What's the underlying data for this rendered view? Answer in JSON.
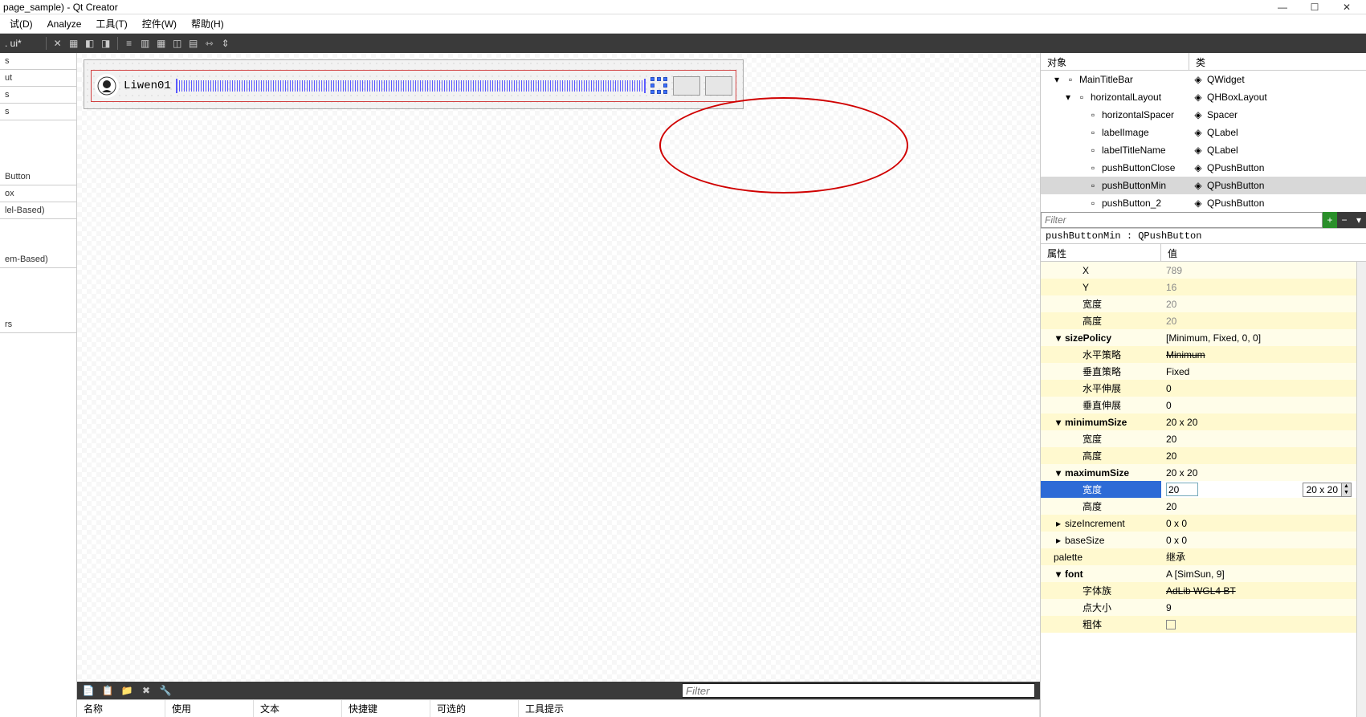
{
  "window": {
    "title": "page_sample) - Qt Creator"
  },
  "menus": [
    "试(D)",
    "Analyze",
    "工具(T)",
    "控件(W)",
    "帮助(H)"
  ],
  "tab_label": ". ui*",
  "canvas": {
    "label_text": "Liwen01"
  },
  "widgetbox": [
    "s",
    "ut",
    "s",
    "s",
    "Button",
    "ox",
    "lel-Based)",
    "em-Based)",
    "rs"
  ],
  "filter_placeholder": "Filter",
  "action_cols": [
    "名称",
    "使用",
    "文本",
    "快捷键",
    "可选的",
    "工具提示"
  ],
  "objtree": {
    "headers": [
      "对象",
      "类"
    ],
    "rows": [
      {
        "indent": 1,
        "chev": "down",
        "name": "MainTitleBar",
        "cls": "QWidget",
        "icon1": "form-icon",
        "icon2": "widget-icon"
      },
      {
        "indent": 2,
        "chev": "down",
        "name": "horizontalLayout",
        "cls": "QHBoxLayout",
        "icon1": "hbox-icon",
        "icon2": "hbox-icon"
      },
      {
        "indent": 3,
        "chev": "",
        "name": "horizontalSpacer",
        "cls": "Spacer",
        "icon1": "",
        "icon2": "spacer-icon"
      },
      {
        "indent": 3,
        "chev": "",
        "name": "labelImage",
        "cls": "QLabel",
        "icon1": "",
        "icon2": "label-icon"
      },
      {
        "indent": 3,
        "chev": "",
        "name": "labelTitleName",
        "cls": "QLabel",
        "icon1": "",
        "icon2": "label-icon"
      },
      {
        "indent": 3,
        "chev": "",
        "name": "pushButtonClose",
        "cls": "QPushButton",
        "icon1": "",
        "icon2": "button-icon"
      },
      {
        "indent": 3,
        "chev": "",
        "name": "pushButtonMin",
        "cls": "QPushButton",
        "icon1": "",
        "icon2": "button-icon",
        "selected": true
      },
      {
        "indent": 3,
        "chev": "",
        "name": "pushButton_2",
        "cls": "QPushButton",
        "icon1": "",
        "icon2": "button-icon"
      }
    ]
  },
  "propeditor": {
    "object_label": "pushButtonMin : QPushButton",
    "headers": [
      "属性",
      "值"
    ],
    "rows": [
      {
        "name": "X",
        "val": "789",
        "indent": 4,
        "gray": true
      },
      {
        "name": "Y",
        "val": "16",
        "indent": 4,
        "gray": true
      },
      {
        "name": "宽度",
        "val": "20",
        "indent": 4,
        "gray": true
      },
      {
        "name": "高度",
        "val": "20",
        "indent": 4,
        "gray": true
      },
      {
        "name": "sizePolicy",
        "val": "[Minimum, Fixed, 0, 0]",
        "indent": 1,
        "chev": "down",
        "bold": true
      },
      {
        "name": "水平策略",
        "val": "Minimum",
        "indent": 4,
        "strike": true
      },
      {
        "name": "垂直策略",
        "val": "Fixed",
        "indent": 4
      },
      {
        "name": "水平伸展",
        "val": "0",
        "indent": 4
      },
      {
        "name": "垂直伸展",
        "val": "0",
        "indent": 4
      },
      {
        "name": "minimumSize",
        "val": "20 x 20",
        "indent": 1,
        "chev": "down",
        "bold": true
      },
      {
        "name": "宽度",
        "val": "20",
        "indent": 4
      },
      {
        "name": "高度",
        "val": "20",
        "indent": 4
      },
      {
        "name": "maximumSize",
        "val": "20 x 20",
        "indent": 1,
        "chev": "down",
        "bold": true
      },
      {
        "name": "宽度",
        "val": "20",
        "indent": 4,
        "selected": true,
        "spin": "20 x 20"
      },
      {
        "name": "高度",
        "val": "20",
        "indent": 4
      },
      {
        "name": "sizeIncrement",
        "val": "0 x 0",
        "indent": 1,
        "chev": "right"
      },
      {
        "name": "baseSize",
        "val": "0 x 0",
        "indent": 1,
        "chev": "right"
      },
      {
        "name": "palette",
        "val": "继承",
        "indent": 1
      },
      {
        "name": "font",
        "val": "A  [SimSun, 9]",
        "indent": 1,
        "chev": "down",
        "bold": true
      },
      {
        "name": "字体族",
        "val": "AdLib WGL4 BT",
        "indent": 4,
        "strike": true
      },
      {
        "name": "点大小",
        "val": "9",
        "indent": 4
      },
      {
        "name": "粗体",
        "val": "",
        "indent": 4,
        "checkbox": true
      }
    ]
  }
}
